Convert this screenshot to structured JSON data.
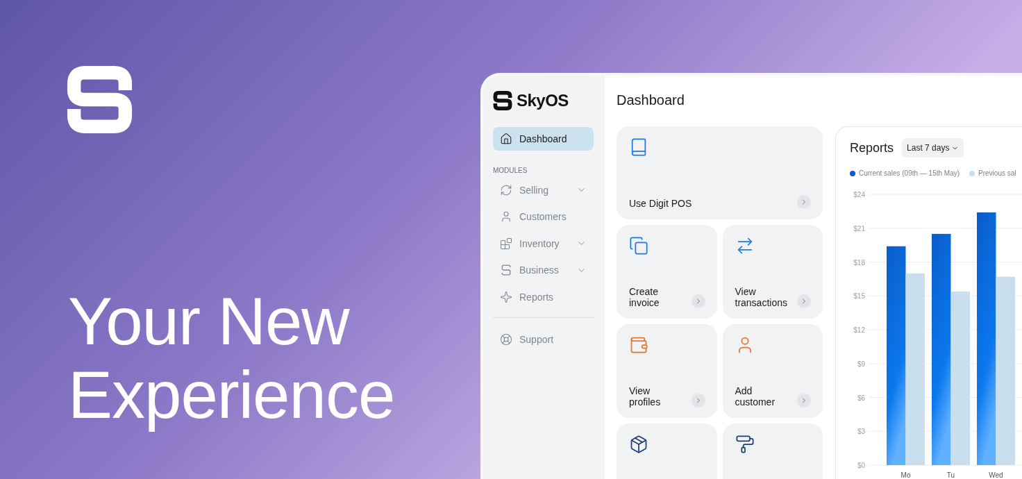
{
  "headline": "Your New Experience",
  "app": {
    "sidebar": {
      "logo": "SkyOS",
      "top_items": [
        {
          "label": "Dashboard",
          "selected": true
        }
      ],
      "section_heading": "MODULES",
      "modules": [
        {
          "label": "Selling",
          "selected": false,
          "expanded": false
        },
        {
          "label": "Customers",
          "selected": false
        },
        {
          "label": "Inventory",
          "selected": false,
          "expanded": false
        },
        {
          "label": "Business",
          "selected": false,
          "expanded": false
        },
        {
          "label": "Reports",
          "selected": false
        }
      ],
      "footer_items": [
        {
          "label": "Support",
          "selected": false
        }
      ]
    },
    "page_title": "Dashboard",
    "tiles": [
      {
        "label": "Use Digit POS",
        "color": "#1b7ce8"
      },
      {
        "label": "Create invoice",
        "color": "#1b7ce8"
      },
      {
        "label": "View transactions",
        "color": "#1b7ce8"
      },
      {
        "label": "View profiles",
        "color": "#e8742e"
      },
      {
        "label": "Add customer",
        "color": "#e8742e"
      },
      {
        "color": "#1e3f74"
      },
      {
        "color": "#1e3f74"
      }
    ],
    "reports": {
      "title": "Reports",
      "range": "Last 7 days",
      "chart_data": {
        "type": "bar",
        "grid": true,
        "categories": [
          "Mo",
          "Tu",
          "Wed"
        ],
        "series": [
          {
            "name": "Current sales (09th — 15th May)",
            "color": "#0a5cc8",
            "values": [
              19.4,
              20.5,
              22.4
            ]
          },
          {
            "name": "Previous sal",
            "color": "#c9dfee",
            "values": [
              17.0,
              15.4,
              16.7
            ]
          }
        ],
        "ylim": [
          0,
          24
        ],
        "yticks": [
          {
            "value": 0,
            "label": "$0"
          },
          {
            "value": 3,
            "label": "$3"
          },
          {
            "value": 6,
            "label": "$6"
          },
          {
            "value": 9,
            "label": "$9"
          },
          {
            "value": 12,
            "label": "$12"
          },
          {
            "value": 15,
            "label": "$15"
          },
          {
            "value": 18,
            "label": "$18"
          },
          {
            "value": 21,
            "label": "$21"
          },
          {
            "value": 24,
            "label": "$24"
          }
        ]
      }
    }
  }
}
